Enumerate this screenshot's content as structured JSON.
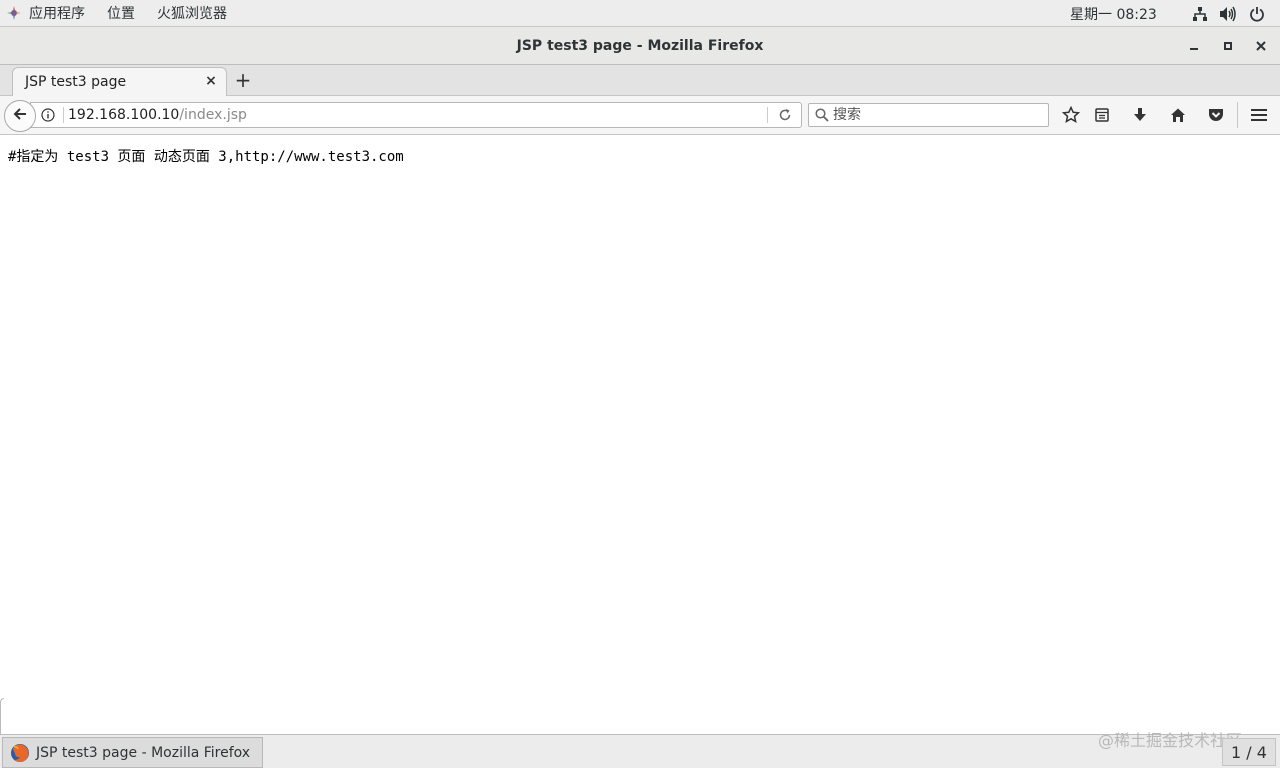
{
  "topbar": {
    "apps_label": "应用程序",
    "places_label": "位置",
    "browser_label": "火狐浏览器",
    "clock": "星期一 08:23",
    "icons": [
      "apps-icon",
      "network-icon",
      "volume-icon",
      "power-icon"
    ]
  },
  "window": {
    "title": "JSP test3 page - Mozilla Firefox"
  },
  "tabs": {
    "active_label": "JSP test3 page",
    "close_glyph": "×",
    "new_tab_glyph": "+"
  },
  "navbar": {
    "url_host": "192.168.100.10",
    "url_path": "/index.jsp",
    "search_placeholder": "搜索",
    "icons": [
      "back-icon",
      "info-icon",
      "reload-icon",
      "search-icon",
      "bookmark-star-icon",
      "reading-list-icon",
      "download-icon",
      "home-icon",
      "pocket-icon",
      "menu-icon"
    ]
  },
  "content": {
    "text": "#指定为 test3 页面 动态页面 3,http://www.test3.com"
  },
  "taskbar": {
    "task_label": "JSP test3 page - Mozilla Firefox",
    "workspace": "1 / 4",
    "watermark": "@稀土掘金技术社区"
  },
  "colors": {
    "topbar_bg": "#ededed",
    "titlebar_bg": "#e8e8e7",
    "toolbar_bg": "#f5f5f5",
    "url_path": "#8a8a8a"
  }
}
